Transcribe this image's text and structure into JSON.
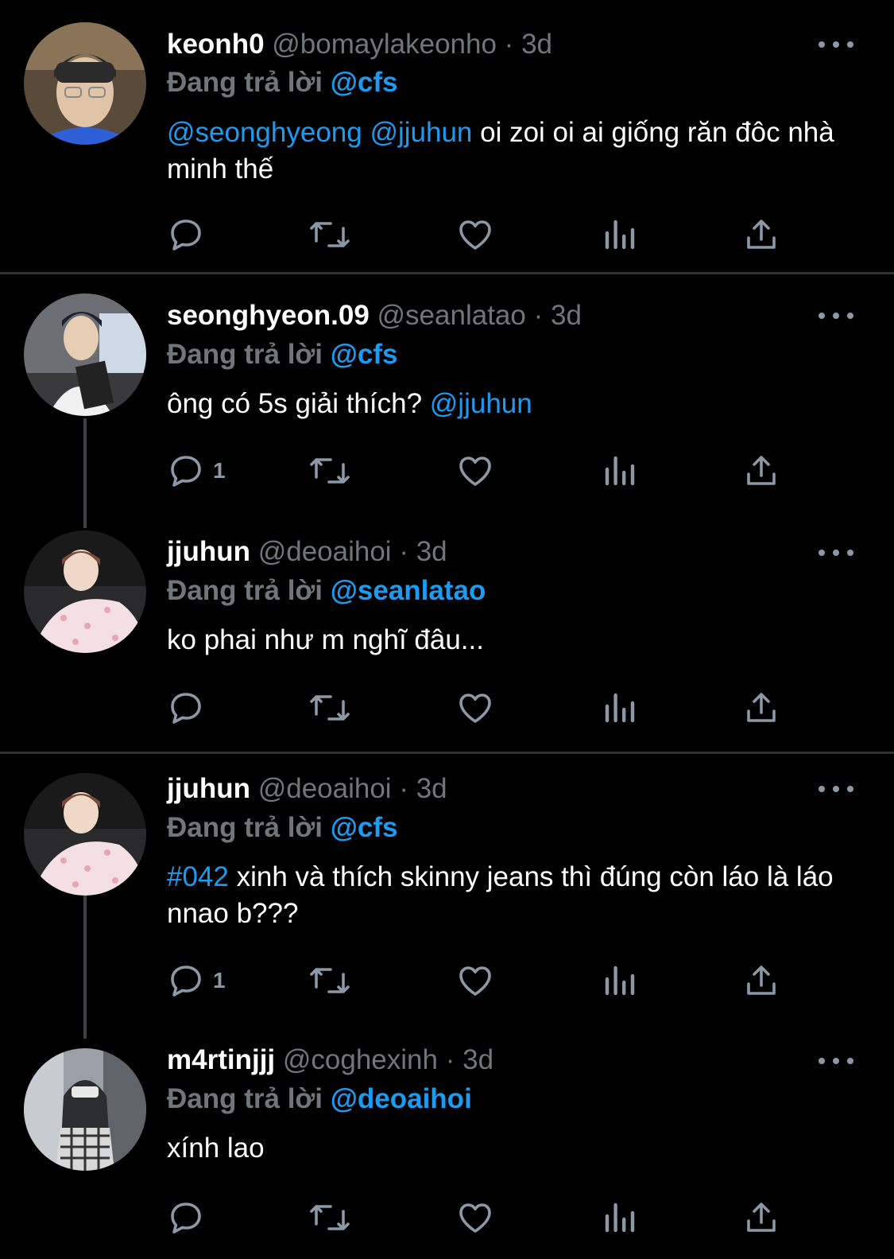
{
  "tweets": [
    {
      "name": "keonh0",
      "handle": "@bomaylakeonho",
      "dot": "·",
      "time": "3d",
      "replying_label": "Đang trả lời",
      "replying_to": "@cfs",
      "mention1": "@seonghyeong",
      "mention2": "@jjuhun",
      "text_rest": " oi zoi oi ai giống răn đôc nhà minh thế",
      "reply_count": ""
    },
    {
      "name": "seonghyeon.09",
      "handle": "@seanlatao",
      "dot": "·",
      "time": "3d",
      "replying_label": "Đang trả lời",
      "replying_to": "@cfs",
      "text_main": "ông có 5s giải thích? ",
      "text_mention": "@jjuhun",
      "reply_count": "1"
    },
    {
      "name": "jjuhun",
      "handle": "@deoaihoi",
      "dot": "·",
      "time": "3d",
      "replying_label": "Đang trả lời",
      "replying_to": "@seanlatao",
      "text_main": "ko phai như m nghĩ đâu...",
      "reply_count": ""
    },
    {
      "name": "jjuhun",
      "handle": "@deoaihoi",
      "dot": "·",
      "time": "3d",
      "replying_label": "Đang trả lời",
      "replying_to": "@cfs",
      "hashtag": "#042",
      "text_rest": " xinh và thích skinny jeans thì đúng còn láo là láo nnao b???",
      "reply_count": "1"
    },
    {
      "name": "m4rtinjjj",
      "handle": "@coghexinh",
      "dot": "·",
      "time": "3d",
      "replying_label": "Đang trả lời",
      "replying_to": "@deoaihoi",
      "text_main": "xính lao",
      "reply_count": ""
    }
  ],
  "icons": {
    "reply": "reply-icon",
    "retweet": "retweet-icon",
    "like": "heart-icon",
    "views": "views-icon",
    "share": "share-icon",
    "more": "more-icon"
  },
  "colors": {
    "background": "#000000",
    "accent": "#1d9bf0",
    "secondary_text": "#71767b",
    "divider": "#2f3336"
  }
}
